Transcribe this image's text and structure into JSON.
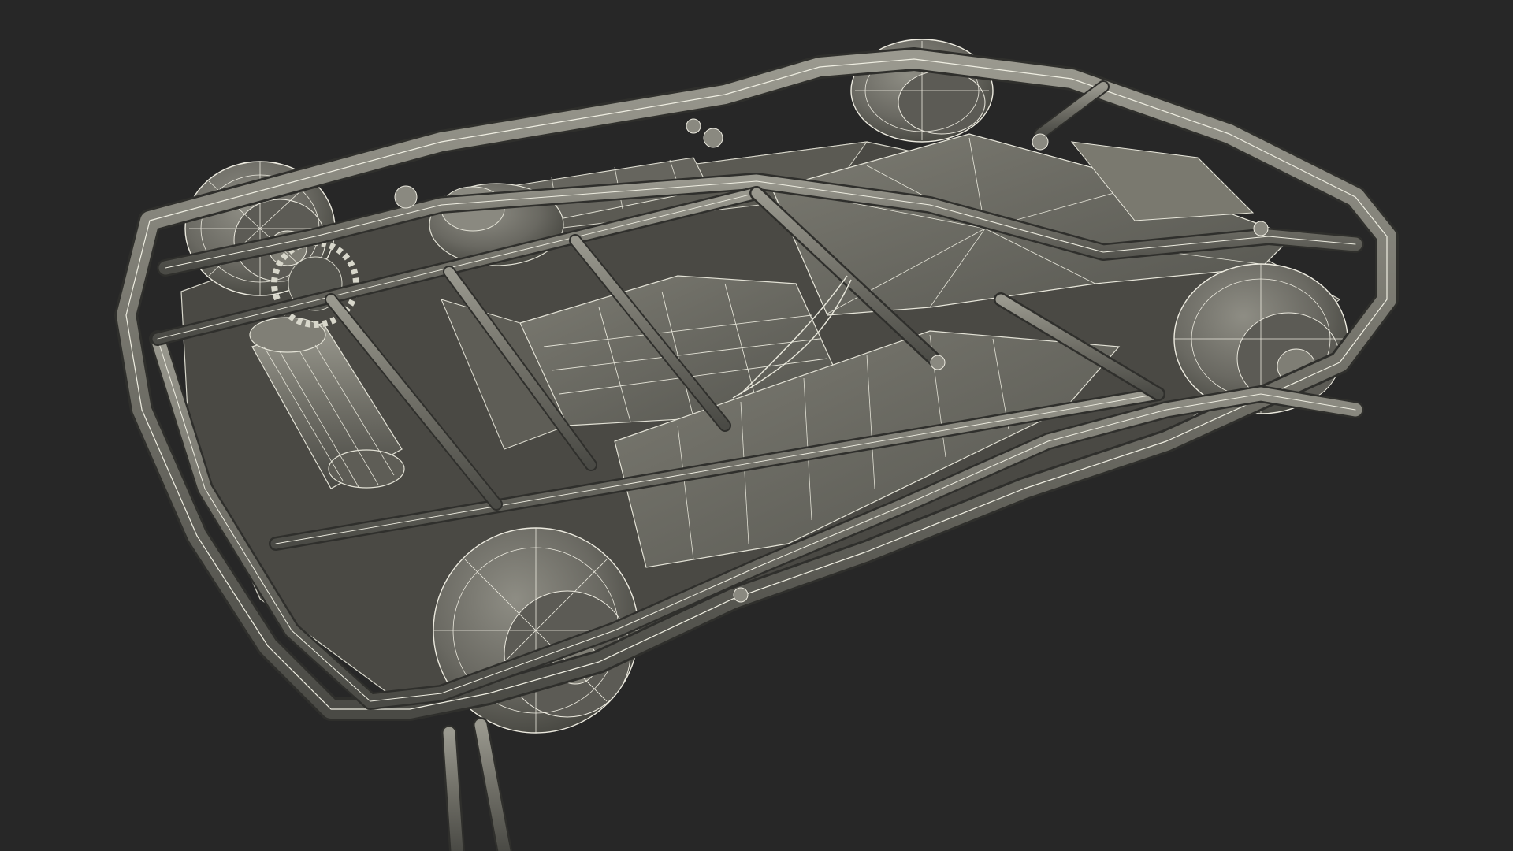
{
  "scene": {
    "background_color": "#272727",
    "model_fill_color": "#6d6c64",
    "model_shadow_color": "#3a3a36",
    "wire_color": "#e9e8dc",
    "subject": "wireframe-3d-model"
  }
}
